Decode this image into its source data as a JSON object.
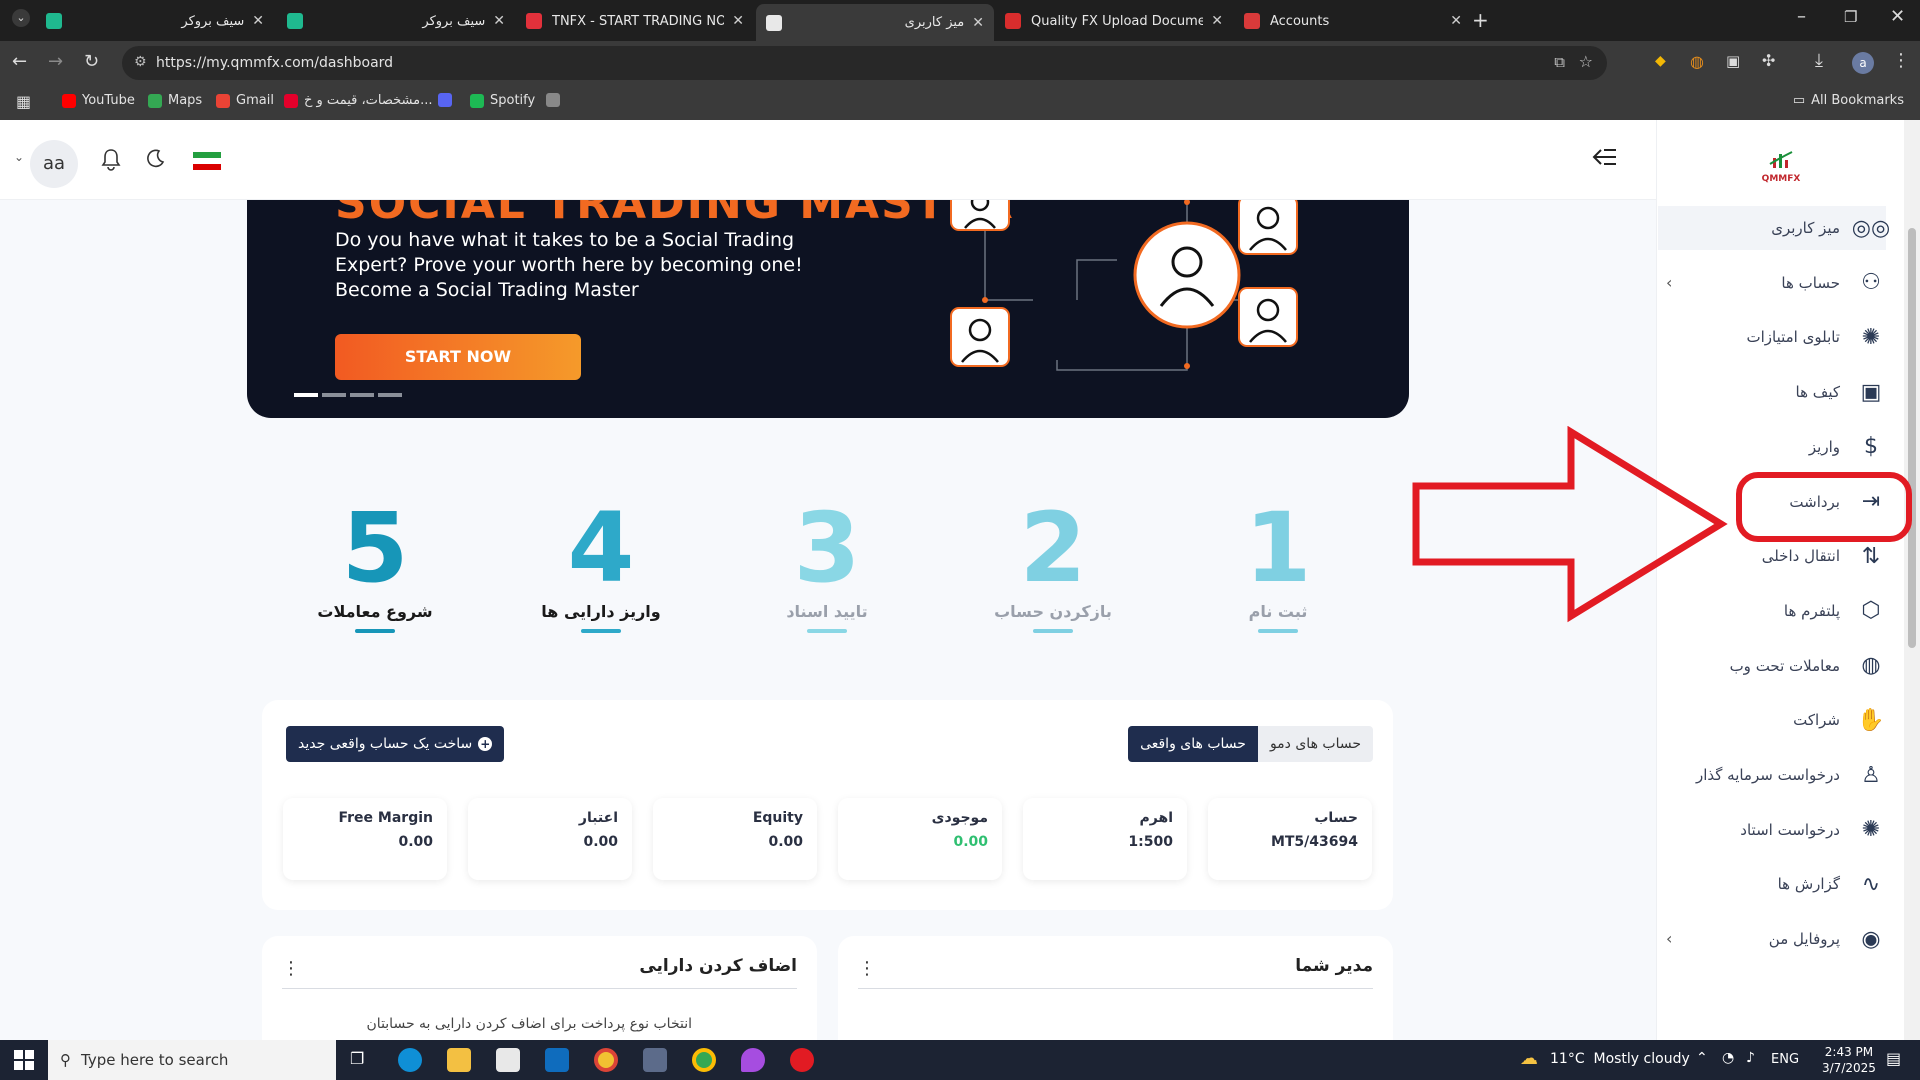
{
  "browser": {
    "tabs": [
      {
        "title": "سیف بروکر",
        "rtl": true,
        "active": false,
        "color": "#1fb98f"
      },
      {
        "title": "سیف بروکر",
        "rtl": true,
        "active": false,
        "color": "#1fb98f"
      },
      {
        "title": "TNFX - START TRADING NOW",
        "rtl": false,
        "active": false,
        "color": "#e2313b"
      },
      {
        "title": "میز کاربری",
        "rtl": true,
        "active": true,
        "color": "#e8e8e8"
      },
      {
        "title": "Quality FX Upload Documents",
        "rtl": false,
        "active": false,
        "color": "#d92d2d"
      },
      {
        "title": "Accounts",
        "rtl": false,
        "active": false,
        "color": "#d93a3a"
      }
    ],
    "url": "https://my.qmmfx.com/dashboard",
    "bookmarks": [
      {
        "label": "YouTube",
        "color": "#ff0000"
      },
      {
        "label": "Maps",
        "color": "#34a853"
      },
      {
        "label": "Gmail",
        "color": "#ea4335"
      },
      {
        "label": "مشخصات، قیمت و خ...",
        "color": "#e4002b"
      },
      {
        "label": "",
        "color": "#5865f2"
      },
      {
        "label": "Spotify",
        "color": "#1db954"
      },
      {
        "label": "",
        "color": "#888888"
      }
    ],
    "all_bookmarks": "All Bookmarks",
    "profile_initial": "a"
  },
  "header": {
    "avatar": "aa"
  },
  "sidebar": {
    "logo": "QMMFX",
    "items": [
      {
        "label": "میز کاربری",
        "icon": "dashboard-icon",
        "glyph": "◎◎",
        "chevron": false,
        "active": true
      },
      {
        "label": "حساب ها",
        "icon": "users-icon",
        "glyph": "⚇",
        "chevron": true,
        "active": false
      },
      {
        "label": "تابلوی امتیازات",
        "icon": "network-icon",
        "glyph": "✺",
        "chevron": false,
        "active": false
      },
      {
        "label": "کیف ها",
        "icon": "wallet-icon",
        "glyph": "▣",
        "chevron": false,
        "active": false
      },
      {
        "label": "واریز",
        "icon": "money-bag-icon",
        "glyph": "$",
        "chevron": false,
        "active": false
      },
      {
        "label": "برداشت",
        "icon": "withdraw-icon",
        "glyph": "⇥",
        "chevron": false,
        "active": false
      },
      {
        "label": "انتقال داخلی",
        "icon": "transfer-icon",
        "glyph": "⇅",
        "chevron": false,
        "active": false
      },
      {
        "label": "پلتفرم ها",
        "icon": "cube-icon",
        "glyph": "⬡",
        "chevron": false,
        "active": false
      },
      {
        "label": "معاملات تحت وب",
        "icon": "globe-icon",
        "glyph": "◍",
        "chevron": false,
        "active": false
      },
      {
        "label": "شراکت",
        "icon": "handshake-icon",
        "glyph": "✋",
        "chevron": false,
        "active": false
      },
      {
        "label": "درخواست سرمایه گذار",
        "icon": "investor-icon",
        "glyph": "♙",
        "chevron": false,
        "active": false
      },
      {
        "label": "درخواست استاد",
        "icon": "master-icon",
        "glyph": "✺",
        "chevron": false,
        "active": false
      },
      {
        "label": "گزارش ها",
        "icon": "report-icon",
        "glyph": "∿",
        "chevron": false,
        "active": false
      },
      {
        "label": "پروفایل من",
        "icon": "profile-icon",
        "glyph": "◉",
        "chevron": true,
        "active": false
      }
    ]
  },
  "banner": {
    "title": "SOCIAL TRADING MASTER",
    "text": "Do you have what it takes to be a Social Trading Expert? Prove your worth here by becoming one! Become a Social Trading Master",
    "button": "START NOW"
  },
  "steps": [
    {
      "num": "1",
      "label": "ثبت نام",
      "color": "#7fd0e2"
    },
    {
      "num": "2",
      "label": "بازکردن حساب",
      "color": "#7fd0e2"
    },
    {
      "num": "3",
      "label": "تایید اسناد",
      "color": "#8ad7e5"
    },
    {
      "num": "4",
      "label": "واریز دارایی ها",
      "color": "#2ea9c9"
    },
    {
      "num": "5",
      "label": "شروع معاملات",
      "color": "#1796b8"
    }
  ],
  "accounts": {
    "tab_demo": "حساب های دمو",
    "tab_real": "حساب های واقعی",
    "create_button": "ساخت یک حساب واقعی جدید",
    "fields": [
      {
        "key": "حساب",
        "value": "MT5/43694",
        "value_color": "#2a3042"
      },
      {
        "key": "اهرم",
        "value": "1:500",
        "value_color": "#2a3042"
      },
      {
        "key": "موجودی",
        "value": "0.00",
        "value_color": "#2fbf71"
      },
      {
        "key": "Equity",
        "value": "0.00",
        "value_color": "#2a3042"
      },
      {
        "key": "اعتبار",
        "value": "0.00",
        "value_color": "#2a3042"
      },
      {
        "key": "Free Margin",
        "value": "0.00",
        "value_color": "#2a3042"
      }
    ]
  },
  "panels": {
    "manager_title": "مدیر شما",
    "add_asset_title": "اضاف کردن دارایی",
    "add_asset_sub": "انتخاب نوع پرداخت برای اضاف کردن دارایی به حسابتان"
  },
  "taskbar": {
    "search_placeholder": "Type here to search",
    "weather": "11°C  Mostly cloudy",
    "lang": "ENG",
    "time": "2:43 PM",
    "date": "3/7/2025"
  },
  "annotation_color": "#e21b23"
}
